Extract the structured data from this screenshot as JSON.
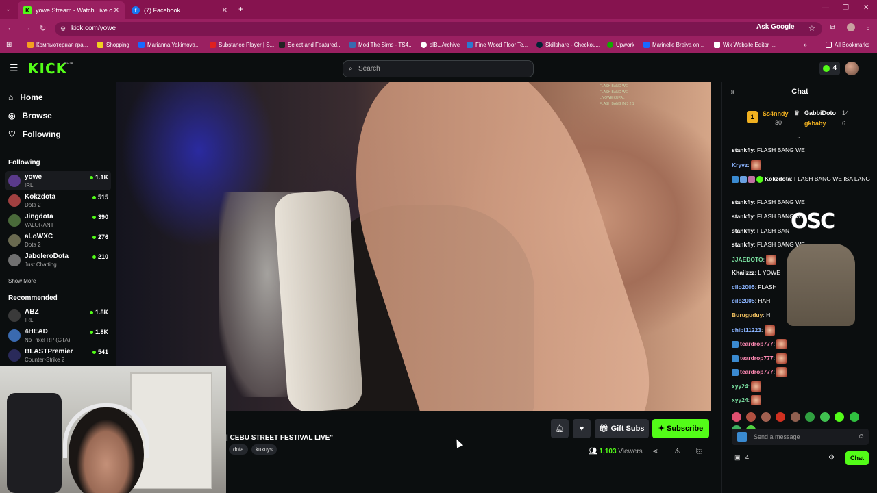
{
  "browser": {
    "tabs": [
      {
        "title": "yowe Stream - Watch Live o",
        "active": true,
        "icon": "kick-favicon"
      },
      {
        "title": "(7) Facebook",
        "active": false,
        "icon": "facebook-favicon"
      }
    ],
    "url": "kick.com/yowe",
    "ask_google": "Ask Google",
    "bookmarks": [
      "Компьютерная гра...",
      "Shopping",
      "Marianna Yakimova...",
      "Substance Player | S...",
      "Select and Featured...",
      "Mod The Sims - TS4...",
      "sIBL Archive",
      "Fine Wood Floor Te...",
      "Skillshare - Checkou...",
      "Upwork",
      "Marinelle Breiva on...",
      "Wix Website Editor |..."
    ],
    "all_bookmarks": "All Bookmarks"
  },
  "header": {
    "logo": "KICK",
    "beta": "BETA",
    "search_placeholder": "Search",
    "notif_count": "4"
  },
  "sidebar": {
    "nav": [
      {
        "label": "Home",
        "icon": "home-icon"
      },
      {
        "label": "Browse",
        "icon": "compass-icon"
      },
      {
        "label": "Following",
        "icon": "heart-icon"
      }
    ],
    "following_heading": "Following",
    "following": [
      {
        "name": "yowe",
        "category": "IRL",
        "viewers": "1.1K",
        "color": "#5a3a8a"
      },
      {
        "name": "Kokzdota",
        "category": "Dota 2",
        "viewers": "515",
        "color": "#a04040"
      },
      {
        "name": "Jingdota",
        "category": "VALORANT",
        "viewers": "390",
        "color": "#4a6a3a"
      },
      {
        "name": "aLoWXC",
        "category": "Dota 2",
        "viewers": "276",
        "color": "#6a6a50"
      },
      {
        "name": "JaboleroDota",
        "category": "Just Chatting",
        "viewers": "210",
        "color": "#707070"
      }
    ],
    "show_more": "Show More",
    "recommended_heading": "Recommended",
    "recommended": [
      {
        "name": "ABZ",
        "category": "IRL",
        "viewers": "1.8K",
        "color": "#3a3a3a"
      },
      {
        "name": "4HEAD",
        "category": "No Pixel RP (GTA)",
        "viewers": "1.8K",
        "color": "#3a6ab0"
      },
      {
        "name": "BLASTPremier",
        "category": "Counter-Strike 2",
        "viewers": "541",
        "color": "#2a2a5a"
      }
    ]
  },
  "stream": {
    "title": "| CEBU STREET FESTIVAL LIVE\"",
    "tags": [
      "dota",
      "kukuys"
    ],
    "gift_subs": "Gift Subs",
    "subscribe": "Subscribe",
    "viewers_count": "1,103",
    "viewers_label": "Viewers",
    "overlay_chat": [
      "FLASH BANG WE",
      "FLASH BANG WE",
      "",
      "L YOWE KUPAL",
      "FLASH BANG IN 3 2 1",
      "",
      "",
      "",
      "",
      "",
      "",
      ""
    ]
  },
  "chat": {
    "title": "Chat",
    "leaderboard": [
      {
        "rank": "1",
        "name": "Ss4nndy",
        "count": "30"
      },
      {
        "name": "GabbiDoto",
        "count": "14"
      },
      {
        "name": "gkbaby",
        "count": "6"
      }
    ],
    "messages": [
      {
        "user": "stankfly",
        "text": "FLASH BANG WE",
        "color": "#ffffff"
      },
      {
        "user": "Kryvz",
        "text": "",
        "color": "#8ab4ff",
        "emote": true
      },
      {
        "user": "Kokzdota",
        "text": "FLASH BANG WE ISA LANG",
        "color": "#ffffff",
        "badges": true
      },
      {
        "user": "stankfly",
        "text": "FLASH BANG WE",
        "color": "#ffffff"
      },
      {
        "user": "stankfly",
        "text": "FLASH BANG WE",
        "color": "#ffffff"
      },
      {
        "user": "stankfly",
        "text": "FLASH BAN",
        "color": "#ffffff"
      },
      {
        "user": "stankfly",
        "text": "FLASH BANG WE",
        "color": "#ffffff"
      },
      {
        "user": "JJAEDOTO",
        "text": "",
        "color": "#7ae0a0",
        "emote": true
      },
      {
        "user": "Khailzzz",
        "text": "L YOWE",
        "color": "#ffffff"
      },
      {
        "user": "cilo2005",
        "text": "FLASH",
        "color": "#8ab4ff"
      },
      {
        "user": "cilo2005",
        "text": "HAH",
        "color": "#8ab4ff"
      },
      {
        "user": "Buruguduy",
        "text": "H",
        "color": "#f0c060"
      },
      {
        "user": "chibi11223",
        "text": "",
        "color": "#8ab4ff",
        "emote": true
      },
      {
        "user": "teardrop777",
        "text": "",
        "color": "#ff8ab4",
        "emote": true
      },
      {
        "user": "teardrop777",
        "text": "",
        "color": "#ff8ab4",
        "emote": true
      },
      {
        "user": "teardrop777",
        "text": "",
        "color": "#ff8ab4",
        "emote": true
      },
      {
        "user": "xyy24",
        "text": "",
        "color": "#7ae0a0",
        "emote": true
      },
      {
        "user": "xyy24",
        "text": "",
        "color": "#7ae0a0",
        "emote": true
      }
    ],
    "send_placeholder": "Send a message",
    "points": "4",
    "chat_button": "Chat",
    "merch_logo": "OSC"
  },
  "colors": {
    "accent": "#53fc18",
    "chrome": "#86134f"
  }
}
